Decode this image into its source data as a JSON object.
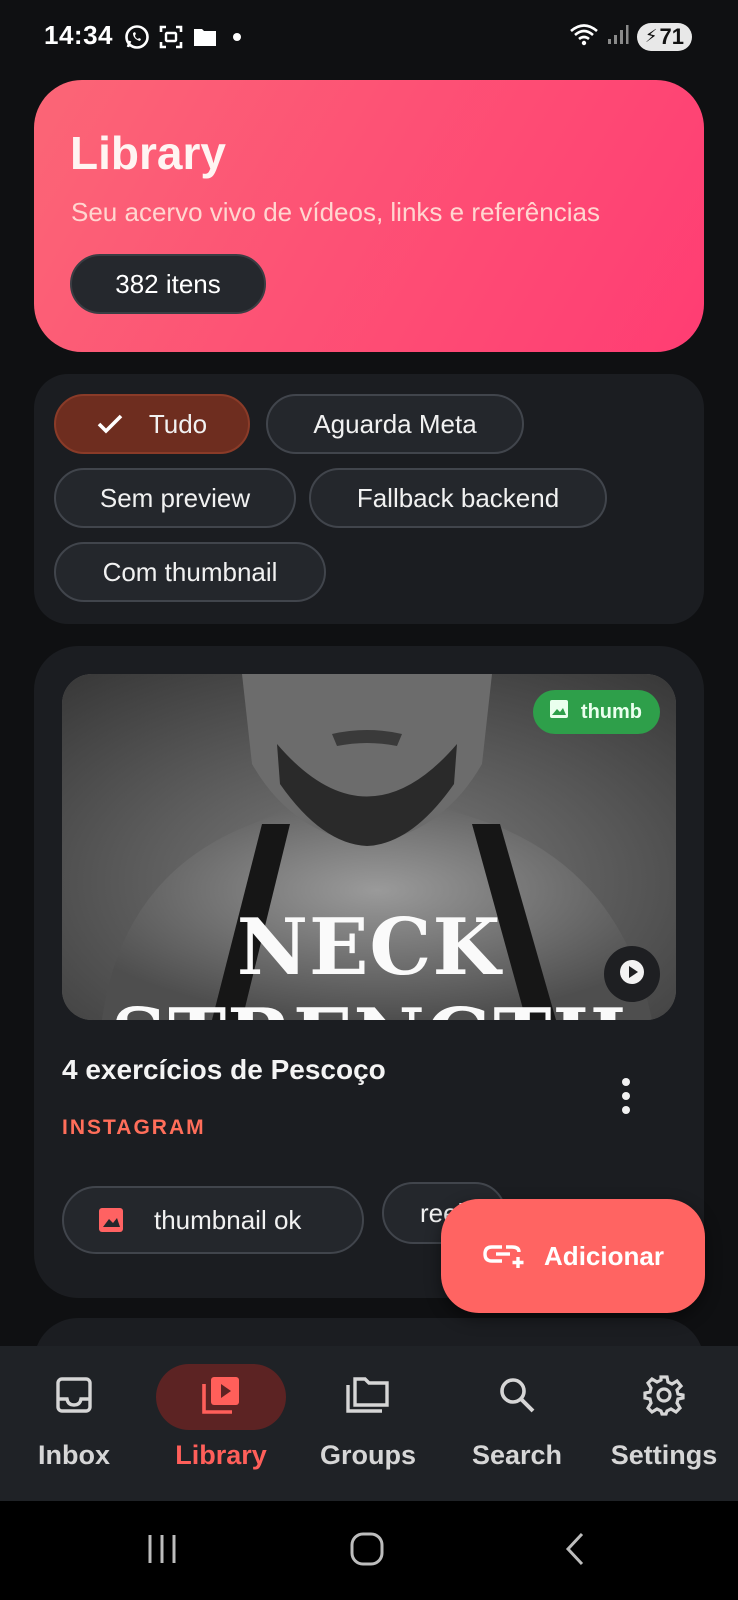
{
  "status_bar": {
    "time": "14:34",
    "battery": "71",
    "left_icons": [
      "whatsapp-icon",
      "screenshot-icon",
      "folder-icon",
      "dot-icon"
    ],
    "right_icons": [
      "wifi-icon",
      "signal-icon",
      "battery-icon"
    ]
  },
  "hero": {
    "title": "Library",
    "subtitle": "Seu acervo vivo de vídeos, links e referências",
    "count": "382 itens",
    "gradient_colors": [
      "#fb6676",
      "#ff3d73"
    ]
  },
  "filters": {
    "chips": [
      {
        "label": "Tudo",
        "selected": true
      },
      {
        "label": "Aguarda Meta",
        "selected": false
      },
      {
        "label": "Sem preview",
        "selected": false
      },
      {
        "label": "Fallback backend",
        "selected": false
      },
      {
        "label": "Com thumbnail",
        "selected": false
      }
    ]
  },
  "card": {
    "thumbnail_text_line1": "NECK",
    "thumbnail_text_line2": "STRENGTH",
    "badge": "thumb",
    "title": "4 exercícios de Pescoço",
    "source": "INSTAGRAM",
    "tags": [
      {
        "label": "thumbnail ok",
        "icon": "image-icon"
      },
      {
        "label": "reel"
      }
    ]
  },
  "fab": {
    "label": "Adicionar",
    "icon": "add-link-icon"
  },
  "bottom_nav": {
    "items": [
      {
        "label": "Inbox",
        "icon": "inbox-icon",
        "active": false
      },
      {
        "label": "Library",
        "icon": "video-library-icon",
        "active": true
      },
      {
        "label": "Groups",
        "icon": "folders-icon",
        "active": false
      },
      {
        "label": "Search",
        "icon": "search-icon",
        "active": false
      },
      {
        "label": "Settings",
        "icon": "gear-icon",
        "active": false
      }
    ]
  },
  "colors": {
    "background": "#0f1012",
    "surface": "#1b1d21",
    "accent": "#ff5f5a",
    "selected_chip": "#6e2d1f",
    "badge_green": "#2e9f4a",
    "source_text": "#ff6e5a"
  }
}
